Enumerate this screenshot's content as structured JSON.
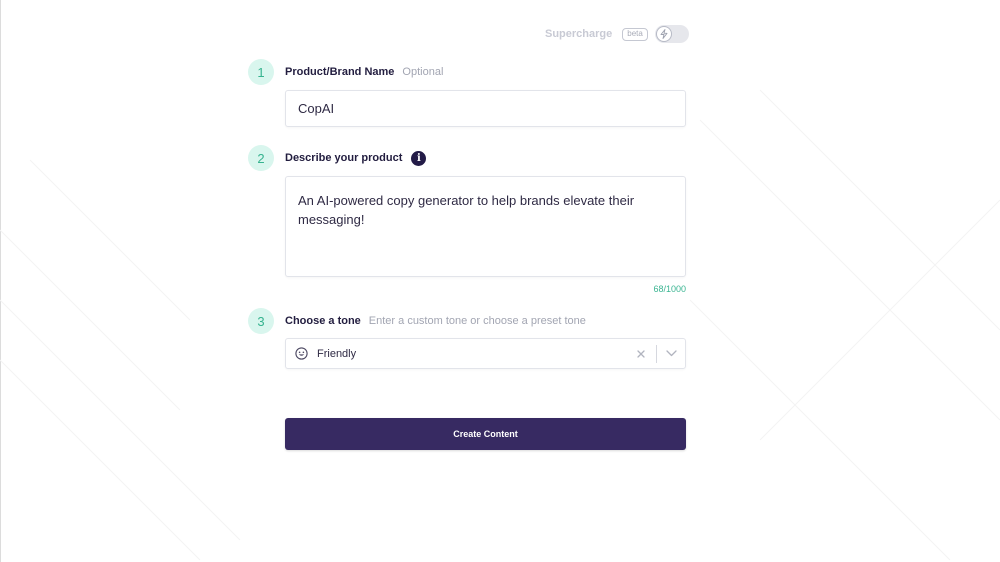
{
  "supercharge": {
    "label": "Supercharge",
    "badge": "beta",
    "enabled": false
  },
  "steps": [
    {
      "number": "1",
      "title": "Product/Brand Name",
      "hint": "Optional",
      "value": "CopAI"
    },
    {
      "number": "2",
      "title": "Describe your product",
      "info_icon": "info-icon",
      "value": "An AI-powered copy generator to help brands elevate their messaging!",
      "char_count": "68/1000"
    },
    {
      "number": "3",
      "title": "Choose a tone",
      "hint": "Enter a custom tone or choose a preset tone",
      "value": "Friendly",
      "value_icon": "smiley-icon"
    }
  ],
  "create_button": {
    "label": "Create Content"
  },
  "colors": {
    "accent_green": "#36b38f",
    "step_bg": "#d9f6ee",
    "primary_button": "#372a62",
    "info_icon_bg": "#231b47"
  }
}
